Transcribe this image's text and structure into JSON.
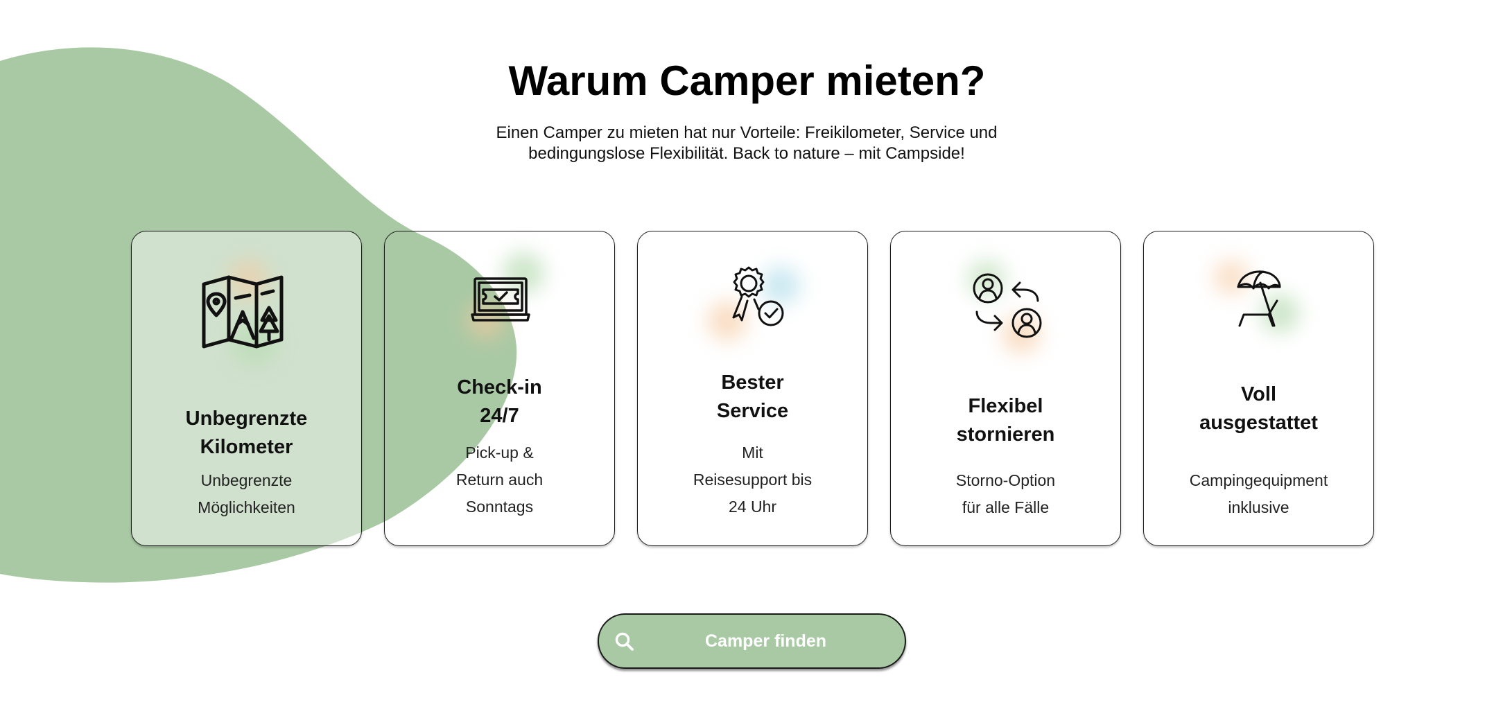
{
  "section": {
    "heading": "Warum Camper mieten?",
    "intro_line1": "Einen Camper zu mieten hat nur Vorteile: Freikilometer, Service und",
    "intro_line2": "bedingungslose Flexibilität. Back to nature – mit Campside!"
  },
  "colors": {
    "accent_green": "#a9c9a4",
    "glow_orange": "#f6c9a0",
    "glow_green": "#b9dcb4",
    "glow_blue": "#bfe3ee"
  },
  "cards": [
    {
      "icon": "map-icon",
      "title_line1": "Unbegrenzte",
      "title_line2": "Kilometer",
      "text_line1": "Unbegrenzte",
      "text_line2": "Möglichkeiten"
    },
    {
      "icon": "laptop-ticket-icon",
      "title_line1": "Check-in",
      "title_line2": "24/7",
      "text_line1": "Pick-up &",
      "text_line2": "Return auch",
      "text_line3": "Sonntags"
    },
    {
      "icon": "award-badge-icon",
      "title_line1": "Bester",
      "title_line2": "Service",
      "text_line1": "Mit",
      "text_line2": "Reisesupport bis",
      "text_line3": "24 Uhr"
    },
    {
      "icon": "user-swap-icon",
      "title_line1": "Flexibel",
      "title_line2": "stornieren",
      "text_line1": "Storno-Option",
      "text_line2": "für alle Fälle"
    },
    {
      "icon": "beach-chair-umbrella-icon",
      "title_line1": "Voll",
      "title_line2": "ausgestattet",
      "text_line1": "Campingequipment",
      "text_line2": "inklusive"
    }
  ],
  "cta": {
    "icon": "search-icon",
    "label": "Camper finden"
  }
}
